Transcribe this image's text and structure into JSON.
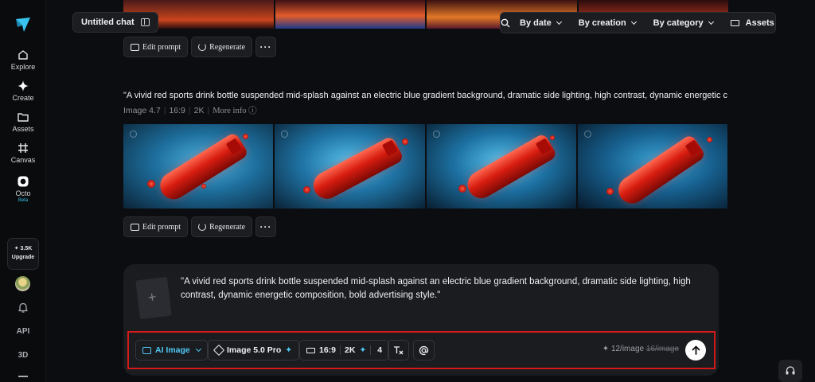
{
  "rail": {
    "items": [
      {
        "label": "Explore",
        "icon": "home-icon"
      },
      {
        "label": "Create",
        "icon": "sparkle-icon"
      },
      {
        "label": "Assets",
        "icon": "folder-icon"
      },
      {
        "label": "Canvas",
        "icon": "canvas-icon"
      },
      {
        "label": "Octo",
        "icon": "octo-icon",
        "badge": "Beta"
      }
    ],
    "credits": "3.5K",
    "upgrade_label": "Upgrade",
    "api_label": "API",
    "three_d_label": "3D"
  },
  "header": {
    "chat_title": "Untitled chat",
    "filters": [
      "By date",
      "By creation",
      "By category"
    ],
    "assets_label": "Assets"
  },
  "actions": {
    "edit_prompt": "Edit prompt",
    "regenerate": "Regenerate",
    "more": "···"
  },
  "generation": {
    "prompt": "\"A vivid red sports drink bottle suspended mid-splash against an electric blue gradient background, dramatic side lighting, high contrast, dynamic energetic c",
    "model": "Image 4.7",
    "ratio": "16:9",
    "resolution": "2K",
    "more_info": "More info"
  },
  "composer": {
    "text": "\"A vivid red sports drink bottle suspended mid-splash against an electric blue gradient background, dramatic side lighting, high contrast, dynamic energetic composition, bold advertising style.\"",
    "add_symbol": "+",
    "mode": "AI Image",
    "model": "Image 5.0 Pro",
    "ratio": "16:9",
    "resolution": "2K",
    "count": "4",
    "price_current": "12/image",
    "price_original": "16/image"
  },
  "colors": {
    "accent": "#4fc8f2",
    "highlight_border": "#d11a1a",
    "background": "#0c0d10"
  }
}
